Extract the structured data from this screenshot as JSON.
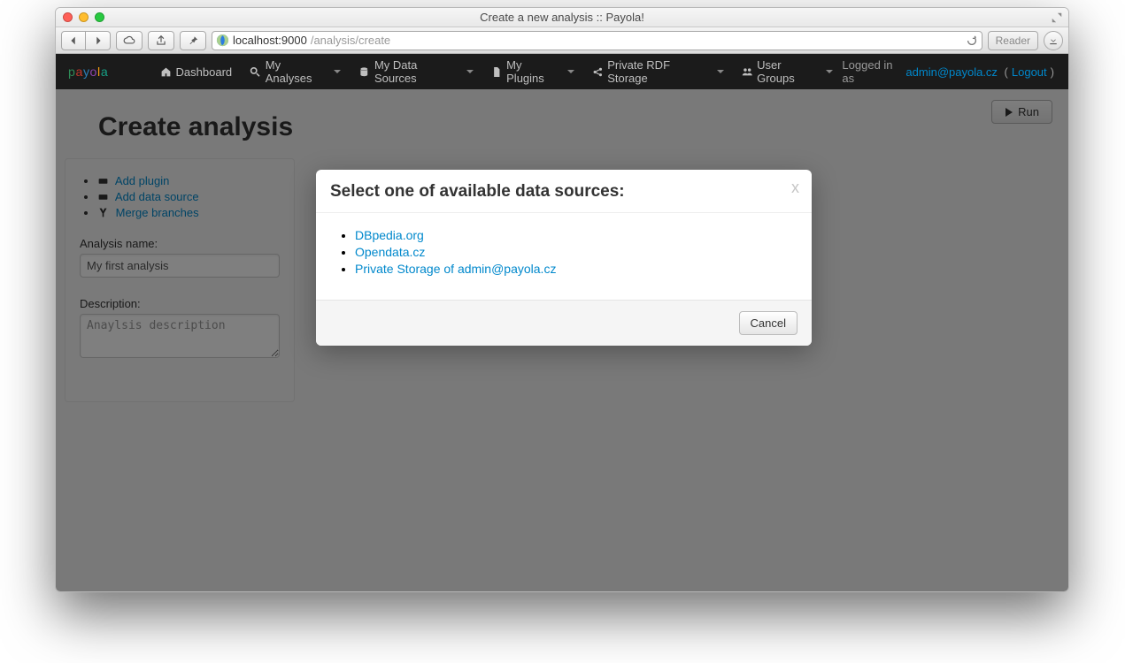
{
  "window": {
    "title": "Create a new analysis :: Payola!"
  },
  "browser": {
    "url_host": "localhost:9000",
    "url_path": "/analysis/create",
    "reader_label": "Reader"
  },
  "navbar": {
    "brand": "payola",
    "items": [
      {
        "label": "Dashboard",
        "dropdown": false
      },
      {
        "label": "My Analyses",
        "dropdown": true
      },
      {
        "label": "My Data Sources",
        "dropdown": true
      },
      {
        "label": "My Plugins",
        "dropdown": true
      },
      {
        "label": "Private RDF Storage",
        "dropdown": true
      },
      {
        "label": "User Groups",
        "dropdown": true
      }
    ],
    "logged_in_prefix": "Logged in as ",
    "user_email": "admin@payola.cz",
    "logout_label": "Logout"
  },
  "page": {
    "heading": "Create analysis",
    "run_label": "Run",
    "side_actions": {
      "add_plugin": "Add plugin",
      "add_data_source": "Add data source",
      "merge_branches": "Merge branches"
    },
    "form": {
      "name_label": "Analysis name:",
      "name_value": "My first analysis",
      "desc_label": "Description:",
      "desc_placeholder": "Anaylsis description"
    }
  },
  "modal": {
    "title": "Select one of available data sources:",
    "options": [
      "DBpedia.org",
      "Opendata.cz",
      "Private Storage of admin@payola.cz"
    ],
    "cancel_label": "Cancel",
    "close_glyph": "x"
  }
}
